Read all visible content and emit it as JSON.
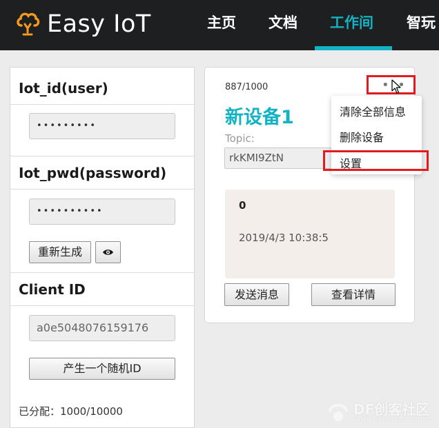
{
  "brand": {
    "name": "Easy IoT",
    "logo_icon": "cloud-bulb-icon",
    "accent_color": "#13b2c4"
  },
  "nav": {
    "items": [
      {
        "label": "主页",
        "active": false
      },
      {
        "label": "文档",
        "active": false
      },
      {
        "label": "工作间",
        "active": true
      },
      {
        "label": "智玩",
        "active": false
      }
    ]
  },
  "credentials": {
    "user_title": "Iot_id(user)",
    "user_value": "•••••••••",
    "password_title": "Iot_pwd(password)",
    "password_value": "••••••••••",
    "regenerate_label": "重新生成",
    "show_password_icon": "eye-icon",
    "client_id_title": "Client ID",
    "client_id_value": "a0e5048076159176",
    "random_id_label": "产生一个随机ID",
    "allocated_text": "已分配：1000/10000"
  },
  "device_card": {
    "count": "887/1000",
    "name": "新设备1",
    "topic_label": "Topic:",
    "topic_value": "rkKMI9ZtN",
    "last_message": "0",
    "last_time": "2019/4/3 10:38:5",
    "send_label": "发送消息",
    "details_label": "查看详情",
    "more_icon": "more-dots-icon",
    "menu_items": [
      "清除全部信息",
      "删除设备",
      "设置"
    ],
    "highlight_color": "#e4191e"
  },
  "watermark": {
    "text": "DF创客社区",
    "sub": "www.DFRobot.com.cn"
  }
}
